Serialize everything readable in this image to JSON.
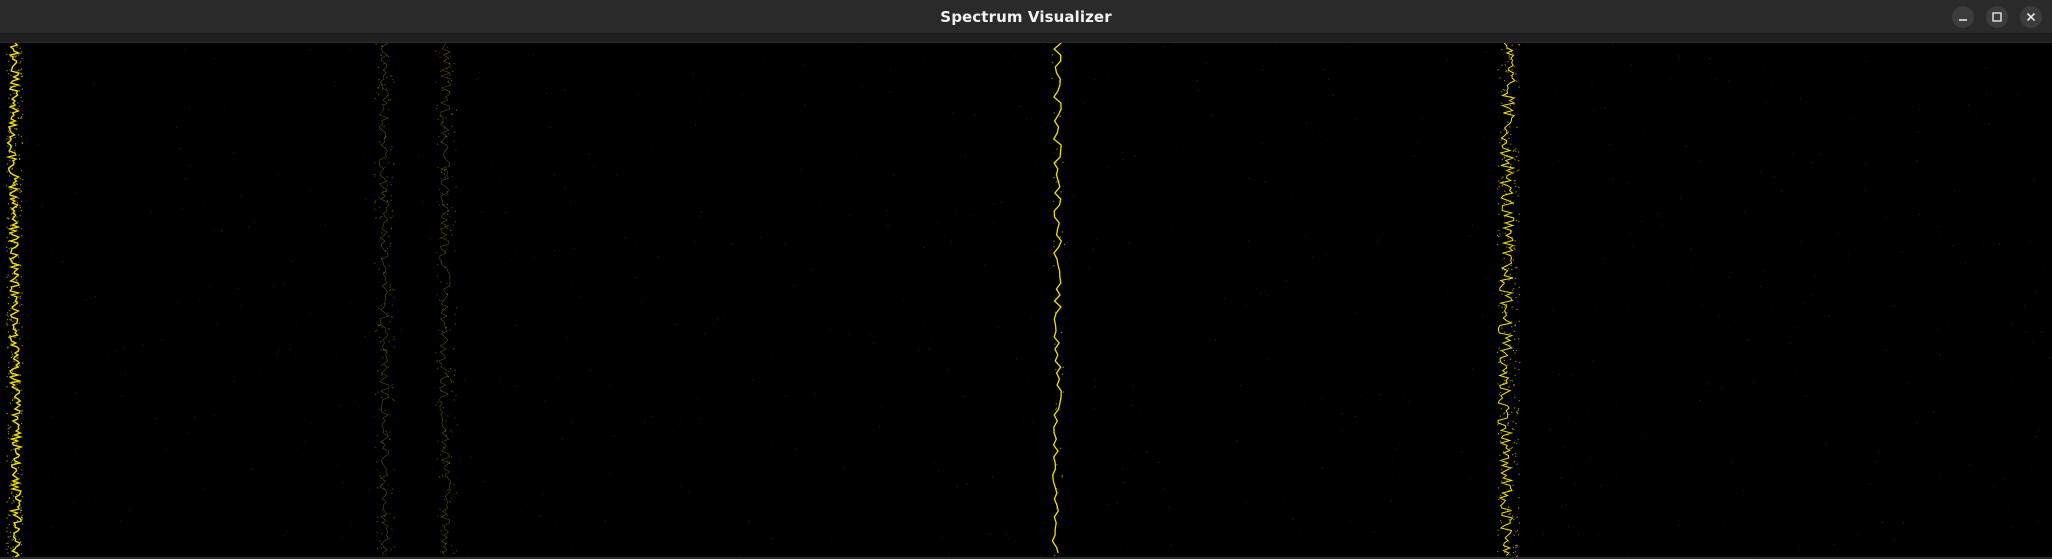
{
  "window": {
    "title": "Spectrum Visualizer"
  },
  "controls": {
    "minimize_icon": "minimize-icon",
    "maximize_icon": "maximize-icon",
    "close_icon": "close-icon"
  },
  "visualizer": {
    "background_color": "#000000",
    "trace_color": "#f2e200",
    "faint_trace_color": "#9a8f00",
    "traces": [
      {
        "id": "trace-1",
        "intensity": "bright"
      },
      {
        "id": "trace-2",
        "intensity": "faint"
      },
      {
        "id": "trace-3",
        "intensity": "faint"
      },
      {
        "id": "trace-4",
        "intensity": "bright"
      },
      {
        "id": "trace-5",
        "intensity": "bright"
      }
    ]
  }
}
